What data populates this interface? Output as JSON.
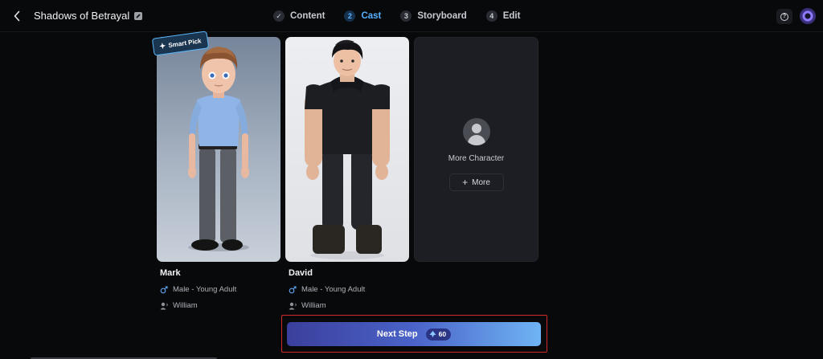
{
  "header": {
    "project_title": "Shadows of Betrayal",
    "steps": [
      {
        "badge": "✓",
        "label": "Content",
        "state": "done"
      },
      {
        "badge": "2",
        "label": "Cast",
        "state": "active"
      },
      {
        "badge": "3",
        "label": "Storyboard",
        "state": "pending"
      },
      {
        "badge": "4",
        "label": "Edit",
        "state": "pending"
      }
    ],
    "help_icon_text": "?"
  },
  "cast": {
    "smart_pick_label": "Smart Pick",
    "characters": [
      {
        "name": "Mark",
        "gender_age": "Male - Young Adult",
        "voice": "William"
      },
      {
        "name": "David",
        "gender_age": "Male - Young Adult",
        "voice": "William"
      }
    ],
    "more_card": {
      "label": "More Character",
      "button_label": "More"
    }
  },
  "footer": {
    "next_label": "Next Step",
    "cost": "60"
  },
  "colors": {
    "accent": "#56b0ff",
    "highlight_frame": "#d22a2a",
    "background": "#08090b"
  }
}
